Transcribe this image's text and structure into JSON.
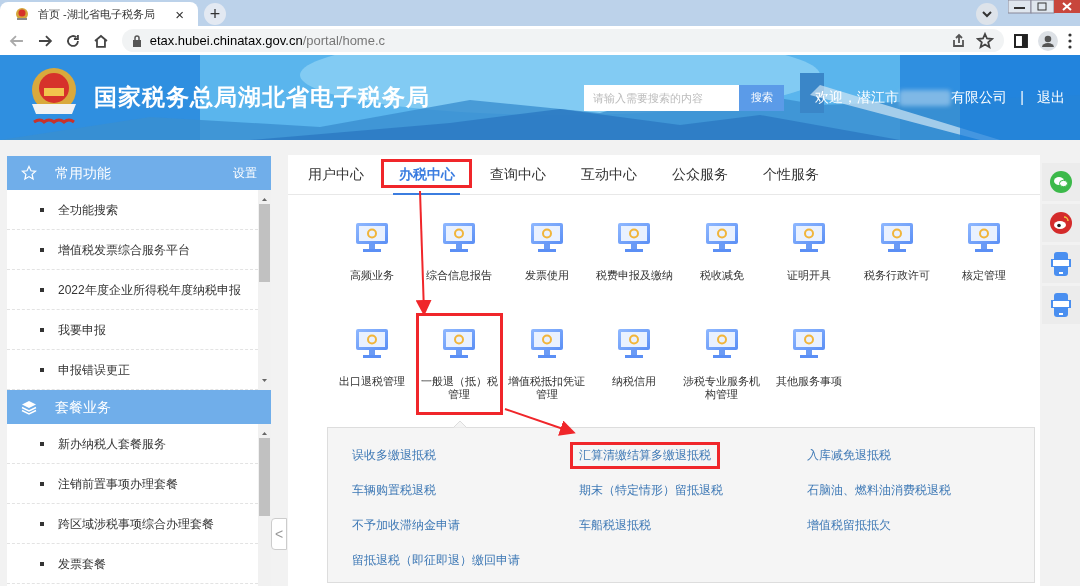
{
  "browser": {
    "tab_title": "首页 -湖北省电子税务局",
    "tab_close": "×",
    "new_tab": "+",
    "url_host": "etax.hubei.chinatax.gov.cn",
    "url_path": "/portal/home.c"
  },
  "header": {
    "title": "国家税务总局湖北省电子税务局",
    "search": {
      "placeholder": "请输入需要搜索的内容",
      "button": "搜索"
    },
    "welcome": "欢迎，潜江市",
    "company_suffix": "有限公司",
    "separator": "|",
    "logout": "退出"
  },
  "sidebar": {
    "sections": [
      {
        "kind": "star",
        "title": "常用功能",
        "action": "设置",
        "items": [
          "全功能搜索",
          "增值税发票综合服务平台",
          "2022年度企业所得税年度纳税申报",
          "我要申报",
          "申报错误更正"
        ]
      },
      {
        "kind": "layers",
        "title": "套餐业务",
        "items": [
          "新办纳税人套餐服务",
          "注销前置事项办理套餐",
          "跨区域涉税事项综合办理套餐",
          "发票套餐"
        ]
      }
    ],
    "collapse": "<"
  },
  "tabs": [
    {
      "label": "用户中心",
      "selected": false,
      "highlighted": false
    },
    {
      "label": "办税中心",
      "selected": true,
      "highlighted": true
    },
    {
      "label": "查询中心",
      "selected": false,
      "highlighted": false
    },
    {
      "label": "互动中心",
      "selected": false,
      "highlighted": false
    },
    {
      "label": "公众服务",
      "selected": false,
      "highlighted": false
    },
    {
      "label": "个性服务",
      "selected": false,
      "highlighted": false
    }
  ],
  "services": [
    {
      "label": "高频业务",
      "highlighted": false
    },
    {
      "label": "综合信息报告",
      "highlighted": false
    },
    {
      "label": "发票使用",
      "highlighted": false
    },
    {
      "label": "税费申报及缴纳",
      "highlighted": false
    },
    {
      "label": "税收减免",
      "highlighted": false
    },
    {
      "label": "证明开具",
      "highlighted": false
    },
    {
      "label": "税务行政许可",
      "highlighted": false
    },
    {
      "label": "核定管理",
      "highlighted": false
    },
    {
      "label": "出口退税管理",
      "highlighted": false
    },
    {
      "label": "一般退（抵）税管理",
      "highlighted": true,
      "submenu": {
        "columns": [
          [
            {
              "label": "误收多缴退抵税",
              "highlighted": false
            },
            {
              "label": "车辆购置税退税",
              "highlighted": false
            },
            {
              "label": "不予加收滞纳金申请",
              "highlighted": false
            },
            {
              "label": "留抵退税（即征即退）缴回申请",
              "highlighted": false
            }
          ],
          [
            {
              "label": "汇算清缴结算多缴退抵税",
              "highlighted": true
            },
            {
              "label": "期末（特定情形）留抵退税",
              "highlighted": false
            },
            {
              "label": "车船税退抵税",
              "highlighted": false
            }
          ],
          [
            {
              "label": "入库减免退抵税",
              "highlighted": false
            },
            {
              "label": "石脑油、燃料油消费税退税",
              "highlighted": false
            },
            {
              "label": "增值税留抵抵欠",
              "highlighted": false
            }
          ]
        ]
      }
    },
    {
      "label": "增值税抵扣凭证管理",
      "highlighted": false
    },
    {
      "label": "纳税信用",
      "highlighted": false
    },
    {
      "label": "涉税专业服务机构管理",
      "highlighted": false
    },
    {
      "label": "其他服务事项",
      "highlighted": false
    }
  ],
  "right_rail": [
    {
      "kind": "wechat"
    },
    {
      "kind": "weibo"
    },
    {
      "kind": "app"
    },
    {
      "kind": "app"
    }
  ]
}
